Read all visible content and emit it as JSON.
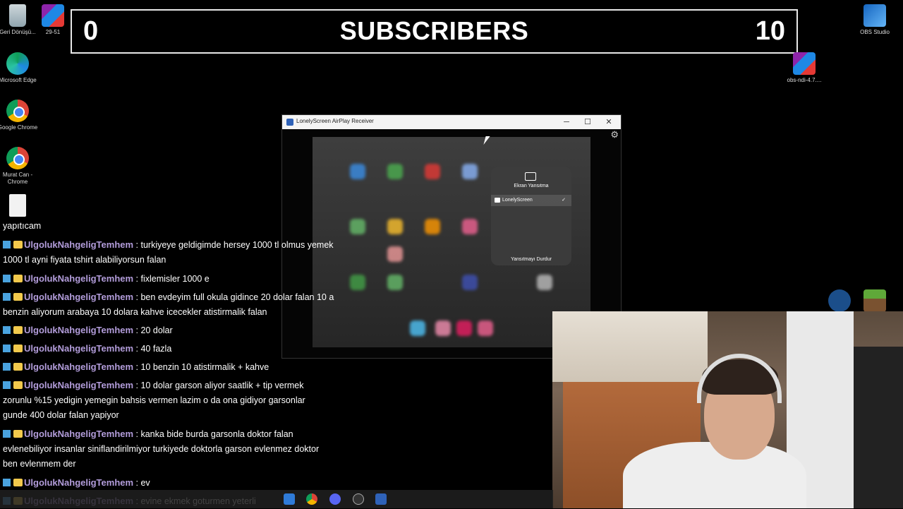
{
  "goal": {
    "left_count": "0",
    "title": "SUBSCRIBERS",
    "right_count": "10"
  },
  "desktop_icons": [
    {
      "label": "Geri Dönüşü...",
      "icon": "recycle-bin-icon"
    },
    {
      "label": "29-51",
      "icon": "winrar-icon"
    },
    {
      "label": "Microsoft Edge",
      "icon": "edge-icon"
    },
    {
      "label": "Google Chrome",
      "icon": "chrome-icon"
    },
    {
      "label": "Murat Can - Chrome",
      "icon": "chrome-icon"
    },
    {
      "label": "OBS Studio",
      "icon": "obs-icon"
    },
    {
      "label": "obs-ndi-4.7....",
      "icon": "winrar-icon"
    }
  ],
  "window": {
    "title": "LonelyScreen AirPlay Receiver",
    "minimize": "─",
    "maximize": "☐",
    "close": "✕",
    "gear": "⚙",
    "control_center": {
      "title": "Ekran Yansıtma",
      "item": "LonelyScreen",
      "check": "✓",
      "stop": "Yansıtmayı Durdur"
    }
  },
  "chat": {
    "first_line": "yapıtıcam",
    "messages": [
      {
        "user": "UlgolukNahgeligTemhem",
        "text": "turkiyeye geldigimde hersey 1000 tl olmus yemek",
        "cont": [
          "1000 tl ayni fiyata tshirt alabiliyorsun falan"
        ]
      },
      {
        "user": "UlgolukNahgeligTemhem",
        "text": "fixlemisler 1000 e",
        "cont": []
      },
      {
        "user": "UlgolukNahgeligTemhem",
        "text": "ben evdeyim full okula gidince 20 dolar falan 10 a",
        "cont": [
          "benzin aliyorum arabaya 10 dolara kahve icecekler atistirmalik falan"
        ]
      },
      {
        "user": "UlgolukNahgeligTemhem",
        "text": "20 dolar",
        "cont": []
      },
      {
        "user": "UlgolukNahgeligTemhem",
        "text": "40 fazla",
        "cont": []
      },
      {
        "user": "UlgolukNahgeligTemhem",
        "text": "10 benzin 10 atistirmalik + kahve",
        "cont": []
      },
      {
        "user": "UlgolukNahgeligTemhem",
        "text": "10 dolar garson aliyor saatlik + tip vermek",
        "cont": [
          "zorunlu %15 yedigin yemegin bahsis vermen lazim o da ona gidiyor garsonlar",
          "gunde 400 dolar falan yapiyor"
        ]
      },
      {
        "user": "UlgolukNahgeligTemhem",
        "text": "kanka bide burda garsonla doktor falan",
        "cont": [
          "evlenebiliyor insanlar siniflandirilmiyor turkiyede doktorla garson evlenmez doktor",
          "ben evlenmem der"
        ]
      },
      {
        "user": "UlgolukNahgeligTemhem",
        "text": "ev",
        "cont": []
      },
      {
        "user": "UlgolukNahgeligTemhem",
        "text": "evine ekmek goturmen yeterli",
        "cont": []
      }
    ]
  }
}
